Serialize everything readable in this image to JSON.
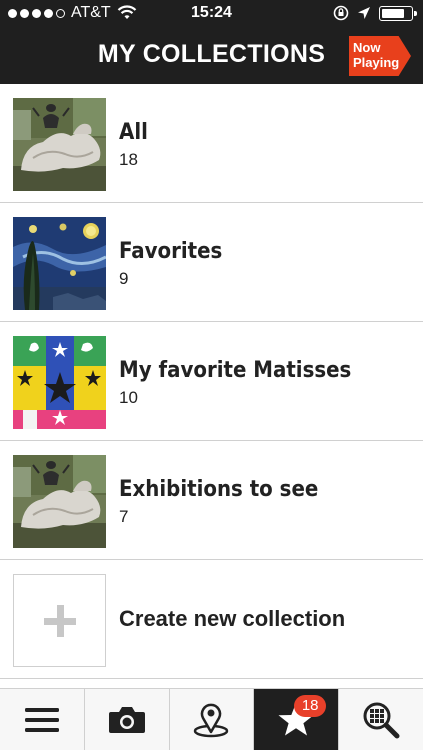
{
  "status_bar": {
    "carrier": "AT&T",
    "time": "15:24",
    "signal_bars_filled": 4,
    "battery_level": 0.85
  },
  "header": {
    "title": "MY COLLECTIONS",
    "now_playing_line1": "Now",
    "now_playing_line2": "Playing",
    "accent_color": "#e8401c"
  },
  "collections": [
    {
      "title": "All",
      "count": "18",
      "thumbnail": "reclining-sculpture"
    },
    {
      "title": "Favorites",
      "count": "9",
      "thumbnail": "starry-night"
    },
    {
      "title": "My favorite Matisses",
      "count": "10",
      "thumbnail": "matisse-cutouts"
    },
    {
      "title": "Exhibitions to see",
      "count": "7",
      "thumbnail": "reclining-sculpture"
    }
  ],
  "create_new": {
    "label": "Create new collection"
  },
  "tabbar": {
    "tabs": [
      {
        "icon": "menu-icon"
      },
      {
        "icon": "camera-icon"
      },
      {
        "icon": "map-pin-icon"
      },
      {
        "icon": "star-icon",
        "badge": "18",
        "active": true
      },
      {
        "icon": "grid-search-icon"
      }
    ]
  }
}
